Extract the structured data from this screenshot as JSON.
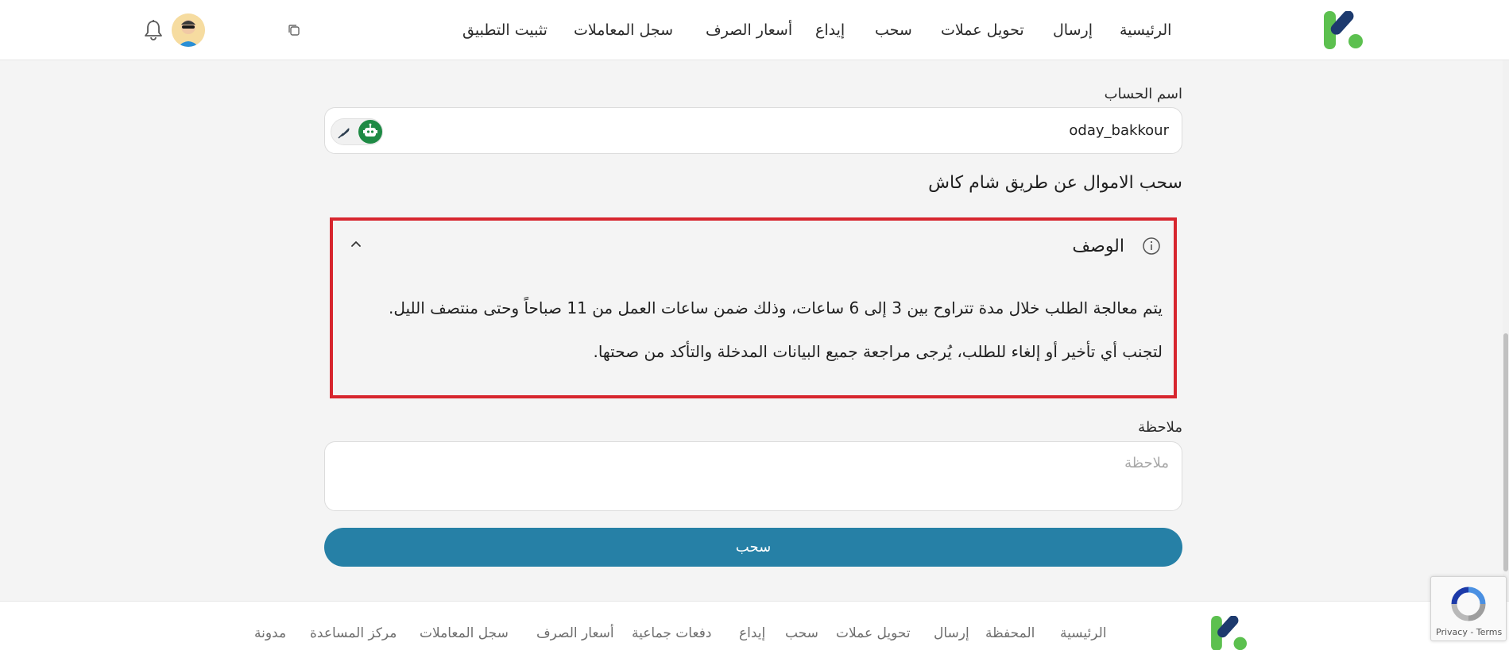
{
  "header": {
    "nav": [
      "الرئيسية",
      "إرسال",
      "تحويل عملات",
      "سحب",
      "إيداع",
      "أسعار الصرف",
      "سجل المعاملات",
      "تثبيت التطبيق"
    ],
    "icons": {
      "logo": "k-logo",
      "copy": "copy-icon",
      "avatar": "user-avatar",
      "bell": "bell-icon"
    }
  },
  "form": {
    "account_label": "اسم الحساب",
    "account_value": "oday_bakkour",
    "section_title": "سحب الاموال عن طريق شام كاش",
    "description": {
      "title": "الوصف",
      "line1": "يتم معالجة الطلب خلال مدة تتراوح بين 3 إلى 6 ساعات، وذلك ضمن ساعات العمل من 11 صباحاً وحتى منتصف الليل.",
      "line2": "لتجنب أي تأخير أو إلغاء للطلب، يُرجى مراجعة جميع البيانات المدخلة والتأكد من صحتها."
    },
    "note_label": "ملاحظة",
    "note_placeholder": "ملاحظة",
    "submit_label": "سحب"
  },
  "footer": {
    "links": [
      "الرئيسية",
      "المحفظة",
      "إرسال",
      "تحويل عملات",
      "سحب",
      "إيداع",
      "دفعات جماعية",
      "أسعار الصرف",
      "سجل المعاملات",
      "مركز المساعدة",
      "مدونة"
    ]
  },
  "recaptcha": {
    "text": "Privacy - Terms"
  },
  "colors": {
    "primary_button": "#2680a6",
    "highlight_border": "#d7262e",
    "logo_green": "#5cc04f",
    "logo_navy": "#1d3a6e",
    "robot_green": "#1e8a44"
  }
}
